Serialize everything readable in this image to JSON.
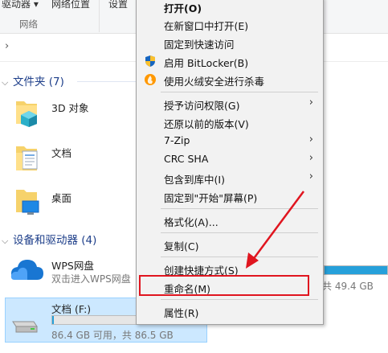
{
  "ribbon": {
    "drives_label": "驱动器 ▾",
    "network_location_label": "网络位置",
    "settings_label": "设置",
    "group_label": "网络"
  },
  "groups": {
    "folders_header": "文件夹 (7)",
    "devices_header": "设备和驱动器 (4)"
  },
  "folders": [
    {
      "label": "3D 对象"
    },
    {
      "label": "文档"
    },
    {
      "label": "桌面"
    }
  ],
  "drives": {
    "wps": {
      "name": "WPS网盘",
      "subtitle": "双击进入WPS网盘",
      "free_text": "共 49.4 GB"
    },
    "f": {
      "name": "文档 (F:)",
      "space_text": "86.4 GB 可用，共 86.5 GB",
      "used_fraction": 0.01
    }
  },
  "context_menu": {
    "items": [
      {
        "label": "打开(O)",
        "bold": true
      },
      {
        "label": "在新窗口中打开(E)"
      },
      {
        "label": "固定到快速访问"
      },
      {
        "label": "启用 BitLocker(B)",
        "icon": "shield-icon"
      },
      {
        "label": "使用火绒安全进行杀毒",
        "icon": "huorong-icon"
      },
      {
        "label": "授予访问权限(G)",
        "submenu": true
      },
      {
        "label": "还原以前的版本(V)"
      },
      {
        "label": "7-Zip",
        "submenu": true
      },
      {
        "label": "CRC SHA",
        "submenu": true
      },
      {
        "label": "包含到库中(I)",
        "submenu": true
      },
      {
        "label": "固定到\"开始\"屏幕(P)"
      },
      {
        "label": "格式化(A)..."
      },
      {
        "label": "复制(C)"
      },
      {
        "label": "创建快捷方式(S)"
      },
      {
        "label": "重命名(M)"
      },
      {
        "label": "属性(R)"
      }
    ],
    "submenu_arrow": "›"
  },
  "annotation_color": "#e0151f"
}
